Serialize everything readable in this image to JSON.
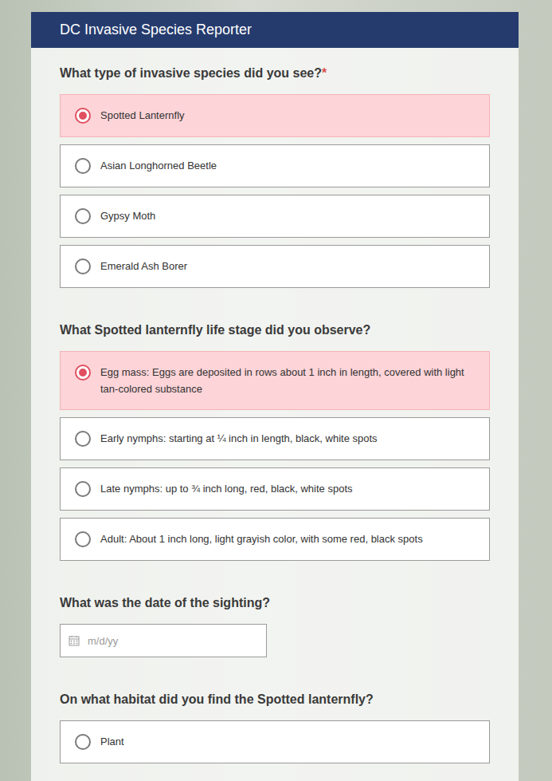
{
  "window": {
    "title": "DC Invasive Species Reporter"
  },
  "questions": [
    {
      "kind": "radio",
      "label": "What type of invasive species did you see?",
      "required": true,
      "required_mark": "*",
      "options": [
        {
          "label": "Spotted Lanternfly",
          "selected": true
        },
        {
          "label": "Asian Longhorned Beetle",
          "selected": false
        },
        {
          "label": "Gypsy Moth",
          "selected": false
        },
        {
          "label": "Emerald Ash Borer",
          "selected": false
        }
      ]
    },
    {
      "kind": "radio",
      "label": "What Spotted lanternfly life stage did you observe?",
      "required": false,
      "required_mark": "",
      "options": [
        {
          "label": "Egg mass: Eggs are deposited in rows about 1 inch in length, covered with light tan-colored substance",
          "selected": true
        },
        {
          "label": "Early nymphs: starting at ¼ inch in length, black, white spots",
          "selected": false
        },
        {
          "label": "Late nymphs: up to ¾ inch long, red, black, white spots",
          "selected": false
        },
        {
          "label": "Adult: About 1 inch long, light grayish color, with some red, black spots",
          "selected": false
        }
      ]
    },
    {
      "kind": "date",
      "label": "What was the date of the sighting?",
      "required": false,
      "required_mark": "",
      "placeholder": "m/d/yy",
      "options": []
    },
    {
      "kind": "radio",
      "label": "On what habitat did you find the Spotted lanternfly?",
      "required": false,
      "required_mark": "",
      "options": [
        {
          "label": "Plant",
          "selected": false
        }
      ]
    }
  ]
}
